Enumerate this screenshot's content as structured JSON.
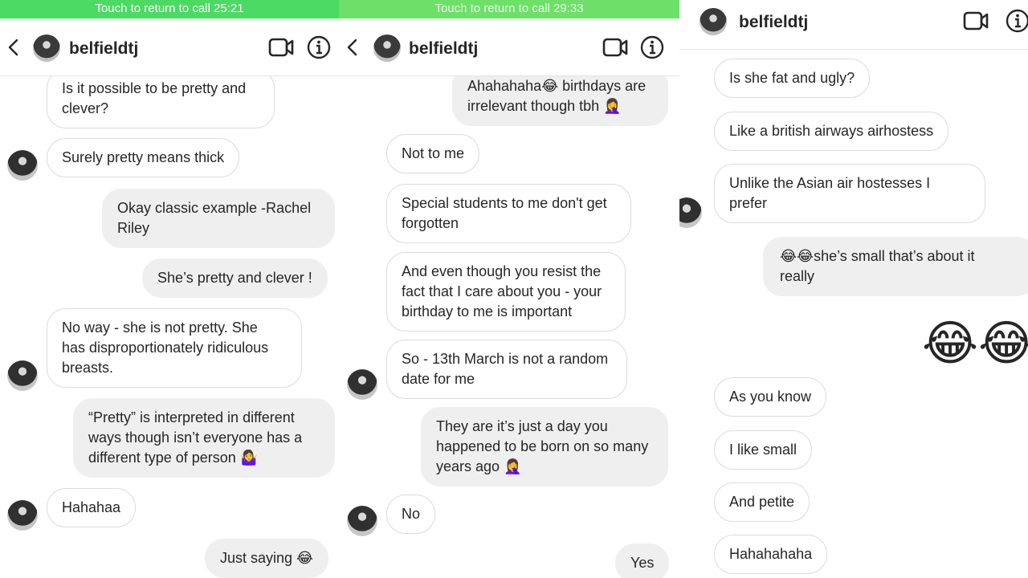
{
  "panel1": {
    "callbar": "Touch to return to call 25:21",
    "username": "belfieldtj",
    "messages": [
      "Is it possible to be pretty and\nclever?",
      "Surely pretty means thick",
      "Okay classic example -Rachel\nRiley",
      "She’s pretty and clever !",
      "No way - she is not pretty. She\nhas disproportionately ridiculous\nbreasts.",
      "“Pretty” is interpreted in different\nways though isn’t everyone has a\ndifferent type of person 🤷‍♀️",
      "Hahahaa",
      "Just saying 😂"
    ]
  },
  "panel2": {
    "callbar": "Touch to return to call 29:33",
    "username": "belfieldtj",
    "messages": [
      "Ahahahaha😂 birthdays are\nirrelevant though tbh 🤦‍♀️",
      "Not to me",
      "Special students to me don't get\nforgotten",
      "And even though you resist the\nfact that I care about you - your\nbirthday to me is important",
      "So - 13th March is not a random\ndate for me",
      "They are it’s just a day you\nhappened to be born on so many\nyears ago 🤦‍♀️",
      "No",
      "Yes"
    ]
  },
  "panel3": {
    "username": "belfieldtj",
    "messages": [
      "Is she fat and ugly?",
      "Like a british airways airhostess",
      "Unlike the Asian air hostesses I\nprefer",
      "😂😂she’s small that’s about it\nreally",
      "😂😂",
      "As you know",
      "I like small",
      "And petite",
      "Hahahahaha"
    ]
  },
  "colors": {
    "callbar": "#4cd964",
    "my_bubble": "#efefef",
    "border": "#dbdbdb"
  },
  "icons": [
    "back-icon",
    "video-call-icon",
    "info-icon"
  ]
}
